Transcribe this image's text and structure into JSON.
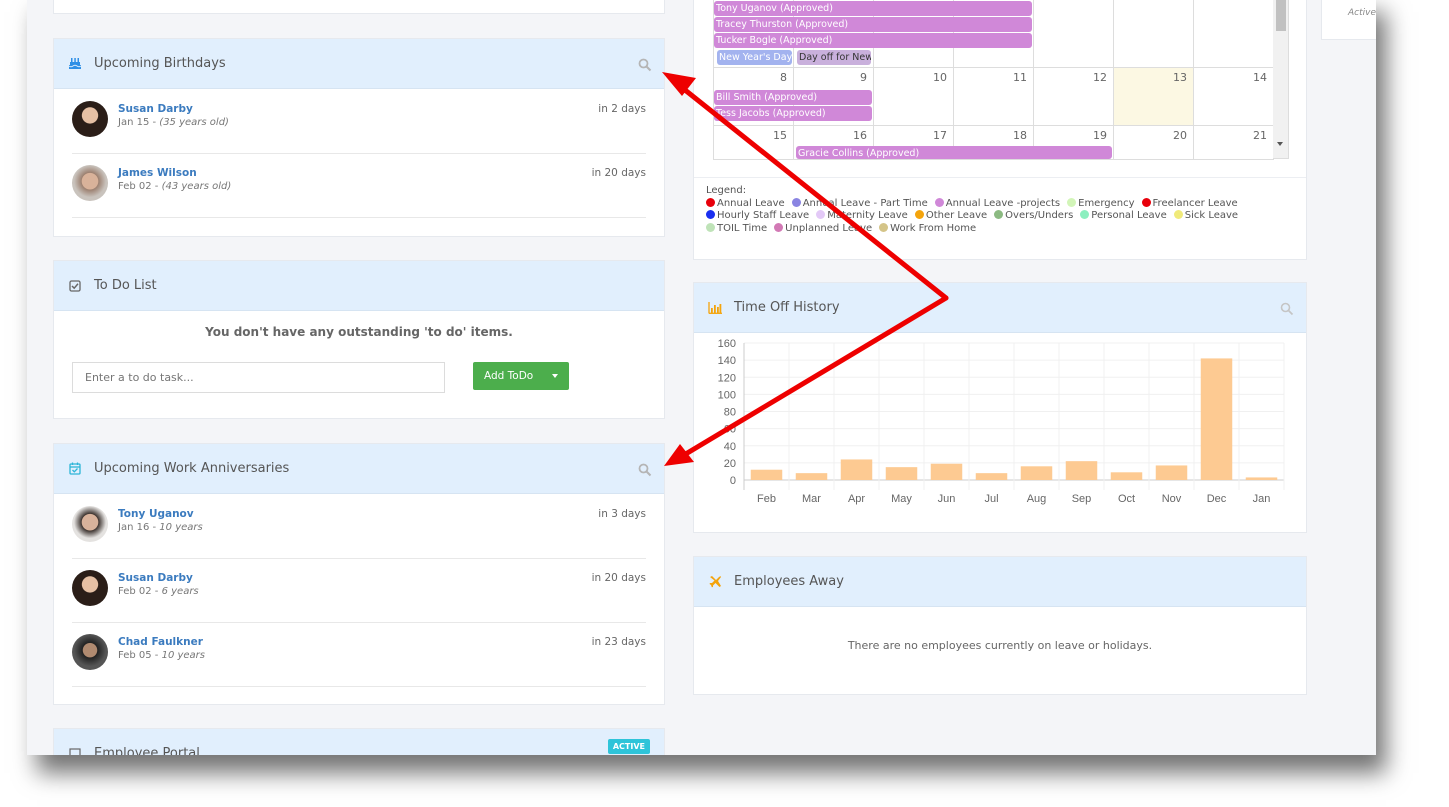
{
  "birthdays": {
    "title": "Upcoming Birthdays",
    "icon": "birthday-cake-icon",
    "items": [
      {
        "name": "Susan Darby",
        "date": "Jan 15 - ",
        "detail": "(35 years old)",
        "when": "in 2 days",
        "avatar_color": "#3a2a22"
      },
      {
        "name": "James Wilson",
        "date": "Feb 02 - ",
        "detail": "(43 years old)",
        "when": "in 20 days",
        "avatar_color": "#a88a70"
      }
    ]
  },
  "todo": {
    "title": "To Do List",
    "icon": "check-square-icon",
    "empty_message": "You don't have any outstanding 'to do' items.",
    "input_placeholder": "Enter a to do task...",
    "add_button": "Add ToDo"
  },
  "anniversaries": {
    "title": "Upcoming Work Anniversaries",
    "icon": "calendar-check-icon",
    "items": [
      {
        "name": "Tony Uganov",
        "date": "Jan 16 - ",
        "detail": "10 years",
        "when": "in 3 days",
        "avatar_color": "#7a6a60"
      },
      {
        "name": "Susan Darby",
        "date": "Feb 02 - ",
        "detail": "6 years",
        "when": "in 20 days",
        "avatar_color": "#3a2a22"
      },
      {
        "name": "Chad Faulkner",
        "date": "Feb 05 - ",
        "detail": "10 years",
        "when": "in 23 days",
        "avatar_color": "#2a2a2a"
      }
    ]
  },
  "portal": {
    "title": "Employee Portal",
    "badge": "ACTIVE"
  },
  "calendar": {
    "week1_events": [
      {
        "label": "Tony Uganov (Approved)",
        "color": "#d088d8"
      },
      {
        "label": "Tracey Thurston (Approved)",
        "color": "#d088d8"
      },
      {
        "label": "Tucker Bogle (Approved)",
        "color": "#d088d8"
      }
    ],
    "holidays": [
      {
        "label": "New Year's Day",
        "color": "#a3b3ef",
        "text_color": "#ffffff"
      },
      {
        "label": "Day off for New",
        "color": "#c9b0dc",
        "text_color": "#333333"
      }
    ],
    "week2_days": [
      "8",
      "9",
      "10",
      "11",
      "12",
      "13",
      "14"
    ],
    "week2_events": [
      {
        "label": "Bill Smith (Approved)"
      },
      {
        "label": "Tess Jacobs (Approved)"
      }
    ],
    "week3_days": [
      "15",
      "16",
      "17",
      "18",
      "19",
      "20",
      "21"
    ],
    "week3_events": [
      {
        "label": "Gracie Collins (Approved)"
      }
    ],
    "today": "13"
  },
  "legend": {
    "title": "Legend:",
    "items": [
      {
        "label": "Annual Leave",
        "color": "#e8000b"
      },
      {
        "label": "Annual Leave - Part Time",
        "color": "#8a84e2"
      },
      {
        "label": "Annual Leave -projects",
        "color": "#d088d8"
      },
      {
        "label": "Emergency",
        "color": "#d2f5b8"
      },
      {
        "label": "Freelancer Leave",
        "color": "#e8000b"
      },
      {
        "label": "Hourly Staff Leave",
        "color": "#1a2ff0"
      },
      {
        "label": "Maternity Leave",
        "color": "#e3c9f7"
      },
      {
        "label": "Other Leave",
        "color": "#f4a40c"
      },
      {
        "label": "Overs/Unders",
        "color": "#8cba82"
      },
      {
        "label": "Personal Leave",
        "color": "#8cefbf"
      },
      {
        "label": "Sick Leave",
        "color": "#f0ea7a"
      },
      {
        "label": "TOIL Time",
        "color": "#bfe3b8"
      },
      {
        "label": "Unplanned Leave",
        "color": "#d279b5"
      },
      {
        "label": "Work From Home",
        "color": "#d4c488"
      }
    ]
  },
  "time_off": {
    "title": "Time Off History",
    "icon": "bar-chart-icon"
  },
  "away": {
    "title": "Employees Away",
    "icon": "plane-icon",
    "empty_message": "There are no employees currently on leave or holidays."
  },
  "side_panel": {
    "status_text": "Active ("
  },
  "chart_data": {
    "type": "bar",
    "title": "Time Off History",
    "categories": [
      "Feb",
      "Mar",
      "Apr",
      "May",
      "Jun",
      "Jul",
      "Aug",
      "Sep",
      "Oct",
      "Nov",
      "Dec",
      "Jan"
    ],
    "values": [
      12,
      8,
      24,
      15,
      19,
      8,
      16,
      22,
      9,
      17,
      142,
      3
    ],
    "xlabel": "",
    "ylabel": "",
    "ylim": [
      0,
      160
    ],
    "yticks": [
      0,
      20,
      40,
      60,
      80,
      100,
      120,
      140,
      160
    ],
    "grid": true,
    "bar_color": "#fdca92"
  },
  "annotations": {
    "arrow_color": "#ee0000"
  }
}
